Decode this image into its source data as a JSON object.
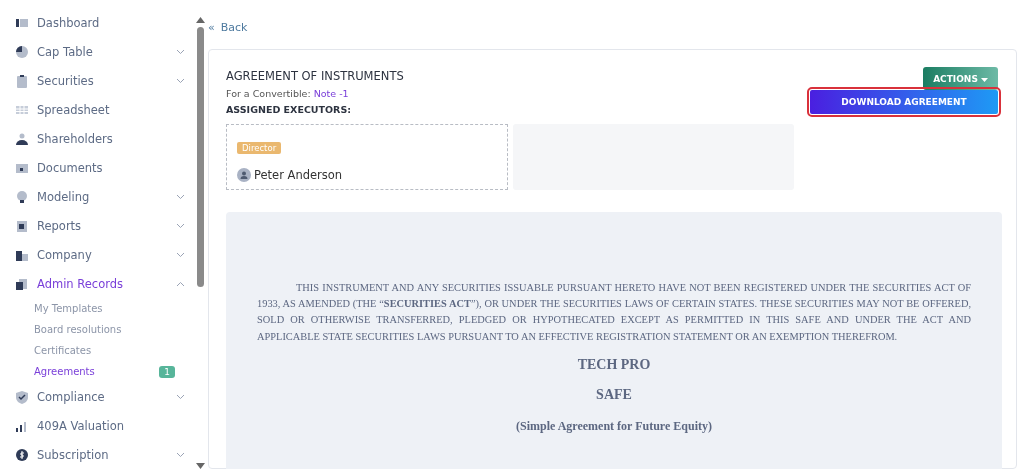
{
  "sidebar": {
    "items": [
      {
        "label": "Dashboard",
        "selected": false
      },
      {
        "label": "Cap Table",
        "selected": false,
        "expanded": false
      },
      {
        "label": "Securities",
        "selected": false,
        "expanded": false
      },
      {
        "label": "Spreadsheet",
        "selected": false
      },
      {
        "label": "Shareholders",
        "selected": false
      },
      {
        "label": "Documents",
        "selected": false
      },
      {
        "label": "Modeling",
        "selected": false,
        "expanded": false
      },
      {
        "label": "Reports",
        "selected": false,
        "expanded": false
      },
      {
        "label": "Company",
        "selected": false,
        "expanded": false
      },
      {
        "label": "Admin Records",
        "selected": true,
        "expanded": true,
        "children": [
          {
            "label": "My Templates",
            "selected": false
          },
          {
            "label": "Board resolutions",
            "selected": false
          },
          {
            "label": "Certificates",
            "selected": false
          },
          {
            "label": "Agreements",
            "selected": true,
            "badge": "1"
          }
        ]
      },
      {
        "label": "Compliance",
        "selected": false,
        "expanded": false
      },
      {
        "label": "409A Valuation",
        "selected": false
      },
      {
        "label": "Subscription",
        "selected": false,
        "expanded": false
      }
    ]
  },
  "back": {
    "icon": "«",
    "label": "Back"
  },
  "agreement": {
    "title": "AGREEMENT OF INSTRUMENTS",
    "subtitle_prefix": "For a Convertible:",
    "subtitle_link": "Note -1",
    "actions_button": "ACTIONS",
    "executors_heading": "ASSIGNED EXECUTORS:",
    "executors": [
      {
        "role": "Director",
        "name": "Peter Anderson"
      }
    ],
    "download_button": "DOWNLOAD AGREEMENT"
  },
  "document": {
    "notice": "THIS INSTRUMENT AND ANY SECURITIES ISSUABLE PURSUANT HERETO HAVE NOT BEEN REGISTERED UNDER THE SECURITIES ACT OF 1933, AS AMENDED (THE “**SECURITIES ACT**”), OR UNDER THE SECURITIES LAWS OF CERTAIN STATES. THESE SECURITIES MAY NOT BE OFFERED, SOLD OR OTHERWISE TRANSFERRED, PLEDGED OR HYPOTHECATED EXCEPT AS PERMITTED IN THIS SAFE AND UNDER THE ACT AND APPLICABLE STATE SECURITIES LAWS PURSUANT TO AN EFFECTIVE REGISTRATION STATEMENT OR AN EXEMPTION THEREFROM.",
    "company": "TECH PRO",
    "doc_type": "SAFE",
    "doc_subtitle": "(Simple Agreement for Future Equity)"
  }
}
